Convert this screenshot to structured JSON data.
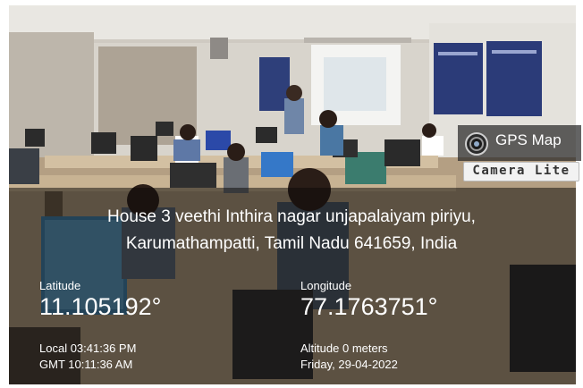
{
  "badge": {
    "app_name": "GPS Map",
    "app_variant": "Camera Lite",
    "icon": "camera-lens-icon"
  },
  "address": {
    "line1": "House 3 veethi Inthira nagar unjapalaiyam piriyu,",
    "line2": "Karumathampatti, Tamil Nadu 641659, India"
  },
  "latitude": {
    "label": "Latitude",
    "value": "11.105192°"
  },
  "longitude": {
    "label": "Longitude",
    "value": "77.1763751°"
  },
  "time": {
    "local": "Local 03:41:36 PM",
    "gmt": "GMT 10:11:36 AM"
  },
  "meta": {
    "altitude": "Altitude 0 meters",
    "date": "Friday, 29-04-2022"
  }
}
